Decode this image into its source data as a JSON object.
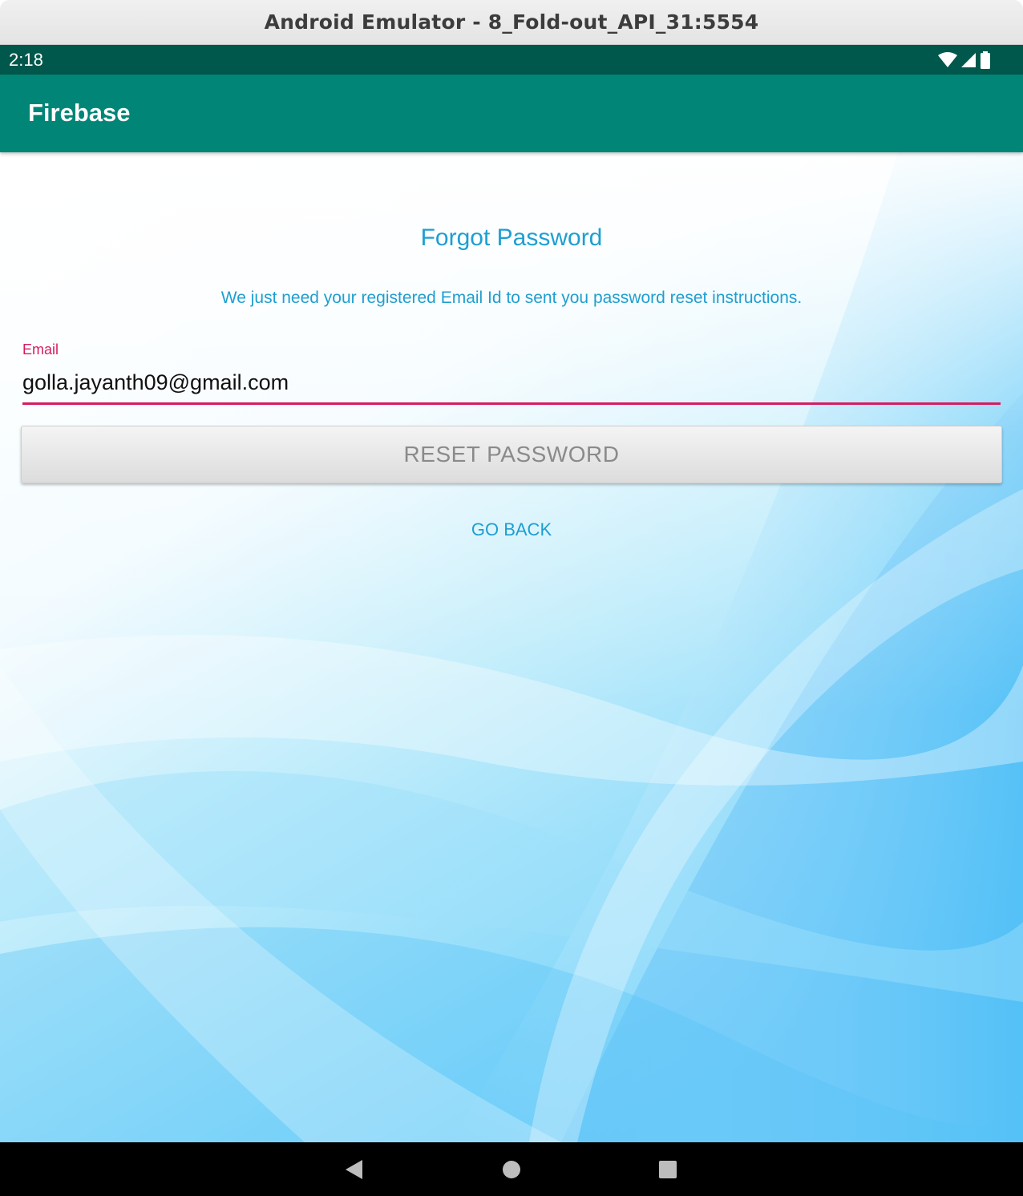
{
  "window": {
    "title": "Android Emulator - 8_Fold-out_API_31:5554"
  },
  "status_bar": {
    "time": "2:18",
    "icons": [
      "wifi-icon",
      "cell-signal-icon",
      "battery-icon"
    ]
  },
  "app_bar": {
    "title": "Firebase",
    "color": "#008577"
  },
  "screen": {
    "heading": "Forgot Password",
    "description": "We just need your registered Email Id to sent you password reset instructions.",
    "email_field": {
      "label": "Email",
      "value": "golla.jayanth09@gmail.com",
      "accent_color": "#d81b60"
    },
    "reset_button_label": "RESET PASSWORD",
    "go_back_label": "GO BACK",
    "text_color": "#1e9fd0"
  },
  "nav_bar": {
    "buttons": [
      "back-icon",
      "home-icon",
      "recents-icon"
    ]
  }
}
